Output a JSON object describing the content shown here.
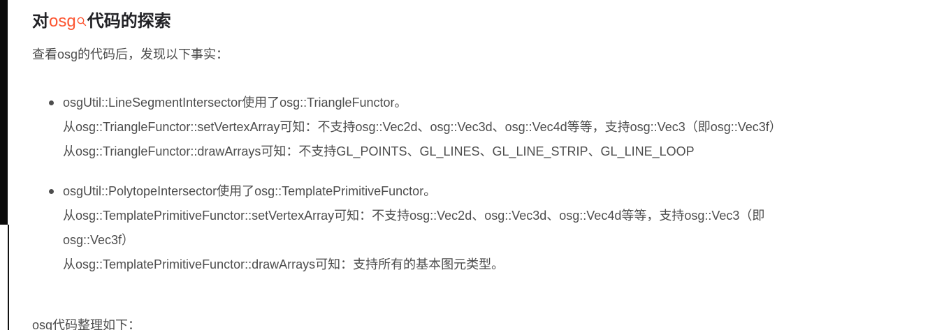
{
  "heading": {
    "prefix": "对",
    "keyword": "osg",
    "suffix": "代码的探索",
    "keyword_color": "#fc5531"
  },
  "intro": "查看osg的代码后，发现以下事实：",
  "facts": [
    {
      "lines": [
        "osgUtil::LineSegmentIntersector使用了osg::TriangleFunctor。",
        "从osg::TriangleFunctor::setVertexArray可知：不支持osg::Vec2d、osg::Vec3d、osg::Vec4d等等，支持osg::Vec3（即osg::Vec3f）",
        "从osg::TriangleFunctor::drawArrays可知：不支持GL_POINTS、GL_LINES、GL_LINE_STRIP、GL_LINE_LOOP"
      ]
    },
    {
      "lines": [
        "osgUtil::PolytopeIntersector使用了osg::TemplatePrimitiveFunctor。",
        "从osg::TemplatePrimitiveFunctor::setVertexArray可知：不支持osg::Vec2d、osg::Vec3d、osg::Vec4d等等，支持osg::Vec3（即",
        "osg::Vec3f）",
        "从osg::TemplatePrimitiveFunctor::drawArrays可知：支持所有的基本图元类型。"
      ]
    }
  ],
  "outro": "osg代码整理如下："
}
